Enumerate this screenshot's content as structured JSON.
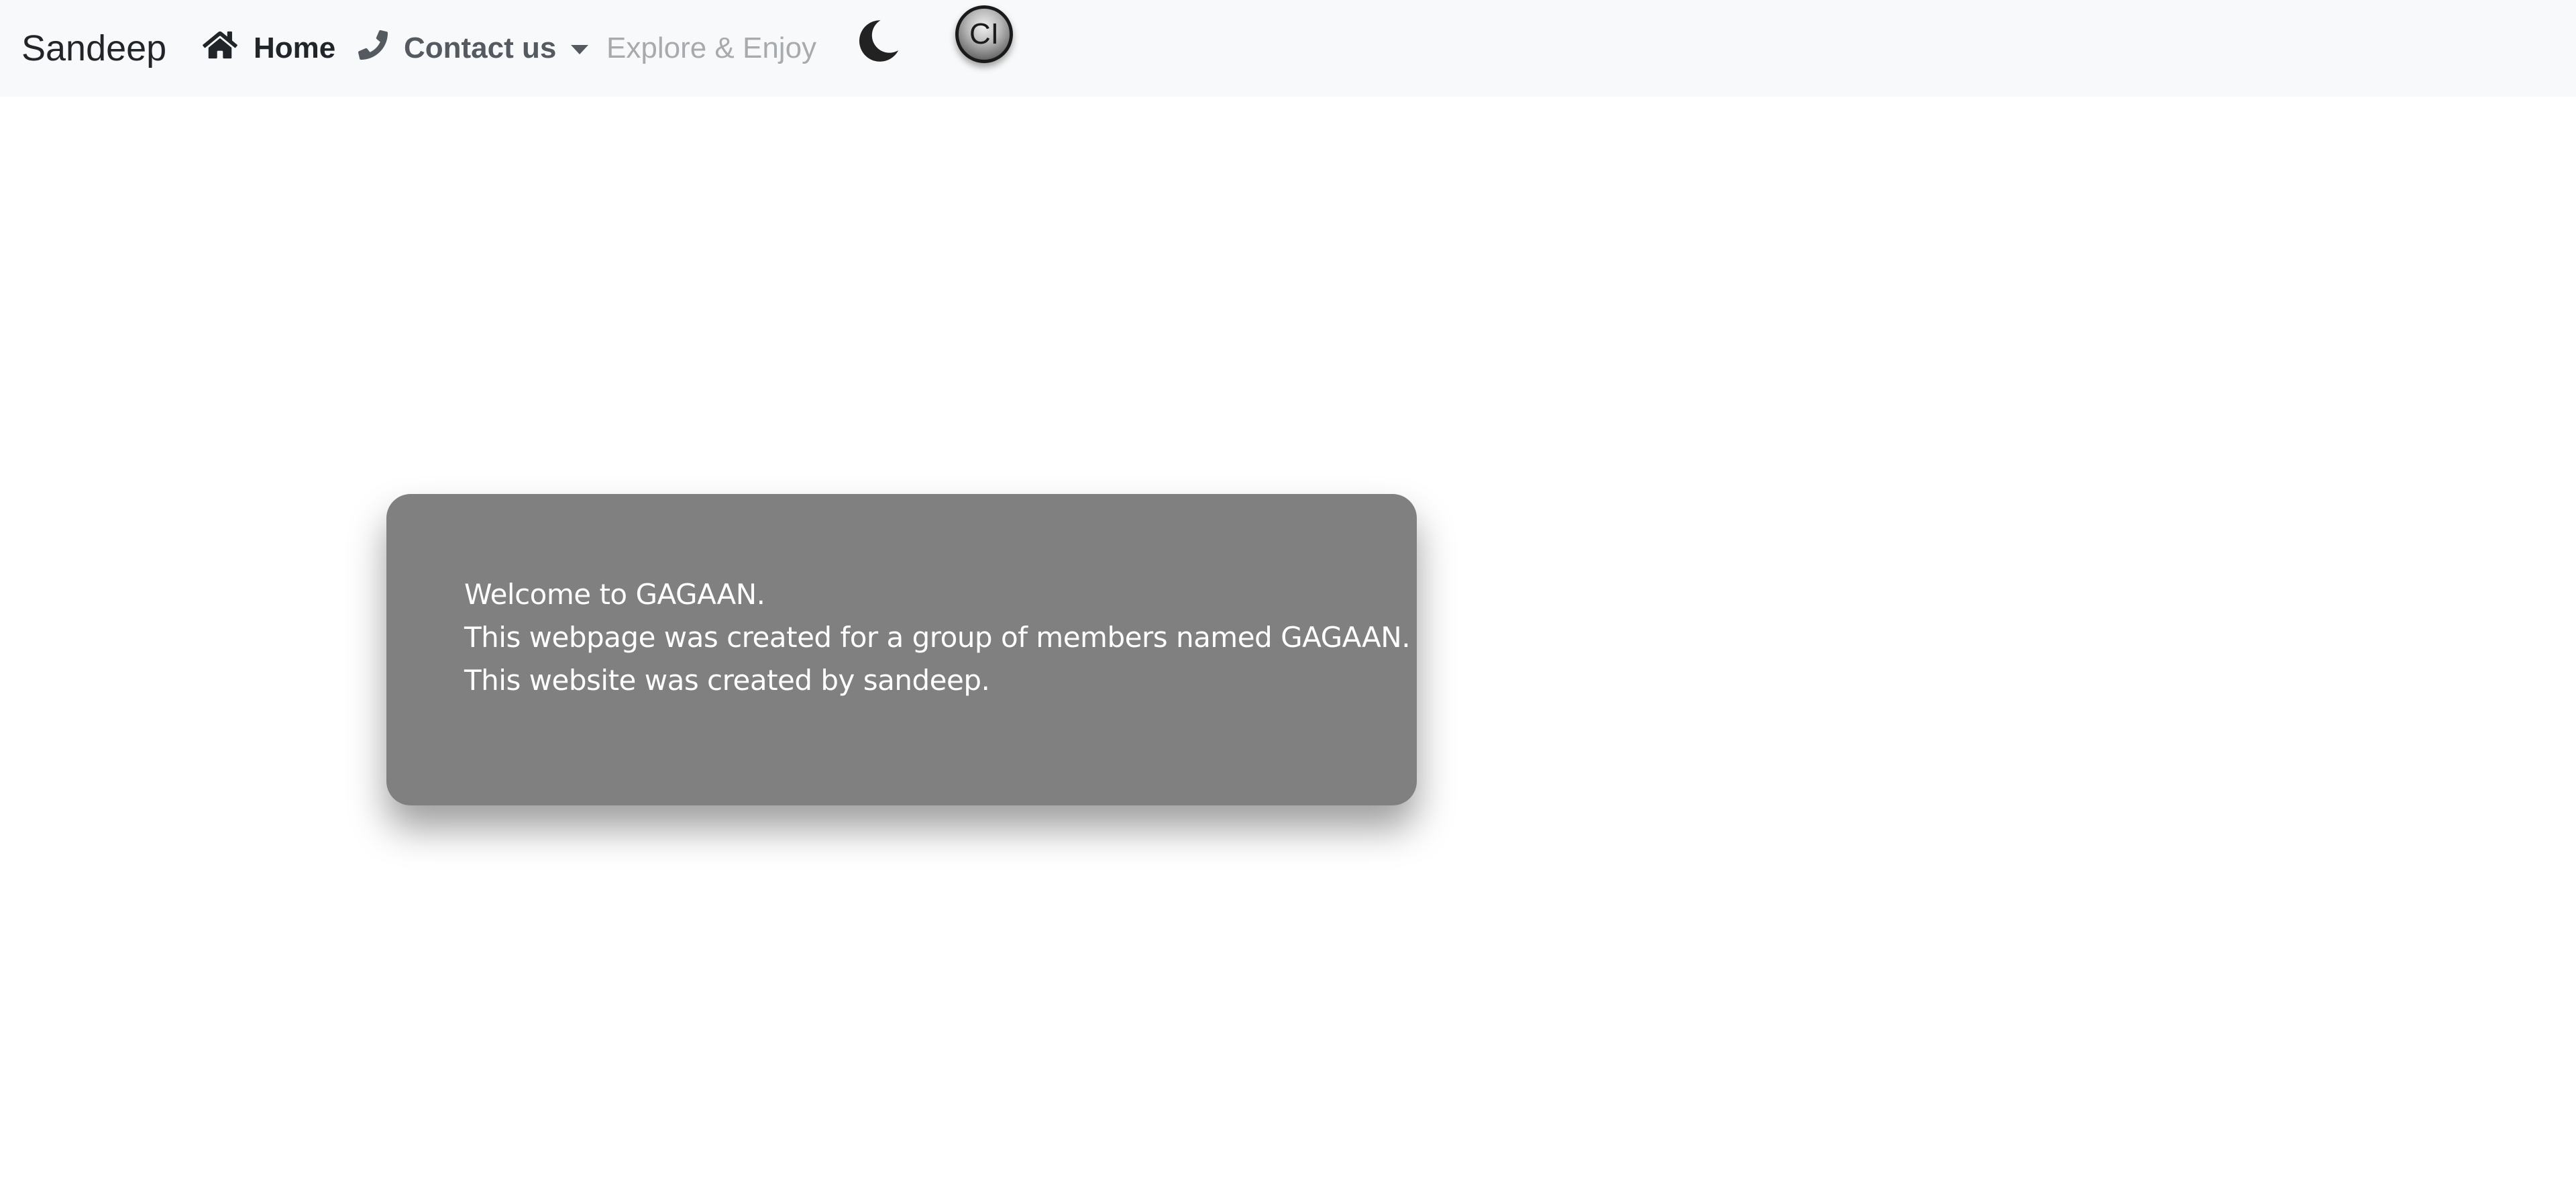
{
  "navbar": {
    "brand": "Sandeep",
    "items": [
      {
        "label": "Home",
        "icon": "home-icon"
      },
      {
        "label": "Contact us",
        "icon": "phone-icon",
        "dropdown": true
      },
      {
        "label": "Explore & Enjoy"
      }
    ],
    "theme_toggle_icon": "moon-icon",
    "badge_text": "CI"
  },
  "card": {
    "line1": "Welcome to GAGAAN.",
    "line2": "This webpage was created for a group of members named GAGAAN.",
    "line3": "This website was created by sandeep."
  },
  "colors": {
    "navbar_bg": "#f8f9fa",
    "card_bg": "#808080",
    "card_text": "#ffffff",
    "muted_link": "#a8abae"
  }
}
